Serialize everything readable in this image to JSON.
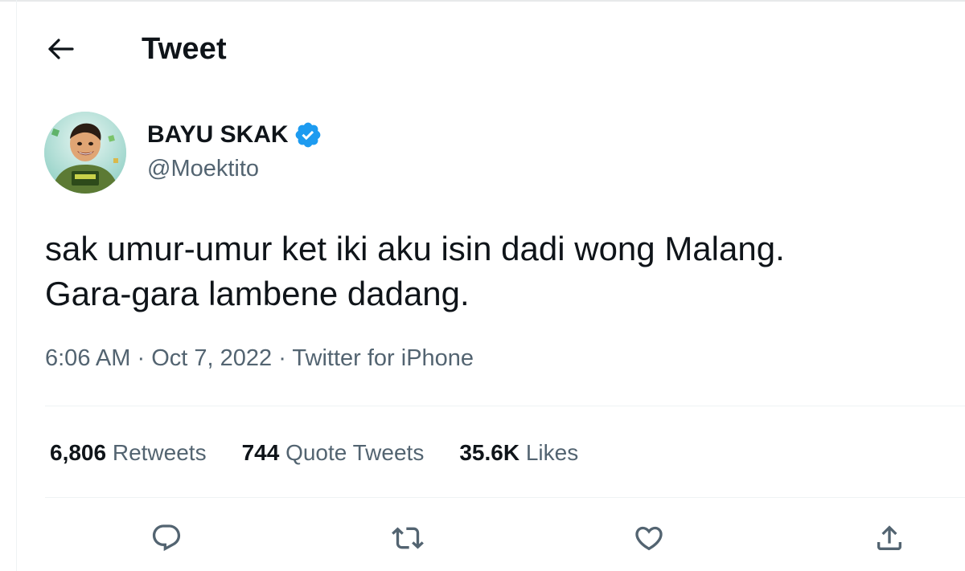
{
  "header": {
    "title": "Tweet",
    "back_icon": "arrow-left-icon"
  },
  "author": {
    "name": "BAYU SKAK",
    "handle": "@Moektito",
    "verified_color": "#1d9bf0"
  },
  "tweet": {
    "text_lines": [
      "sak umur-umur ket iki aku isin dadi wong Malang.",
      "Gara-gara lambene dadang."
    ],
    "time": "6:06 AM",
    "date": "Oct 7, 2022",
    "source": "Twitter for iPhone"
  },
  "stats": {
    "retweets_count": "6,806",
    "retweets_label": "Retweets",
    "quotes_count": "744",
    "quotes_label": "Quote Tweets",
    "likes_count": "35.6K",
    "likes_label": "Likes"
  },
  "actions": {
    "icons": [
      "reply-icon",
      "retweet-icon",
      "like-icon",
      "share-icon"
    ]
  },
  "colors": {
    "text": "#0f1419",
    "secondary": "#536471",
    "divider": "#eff3f4",
    "accent": "#1d9bf0"
  }
}
